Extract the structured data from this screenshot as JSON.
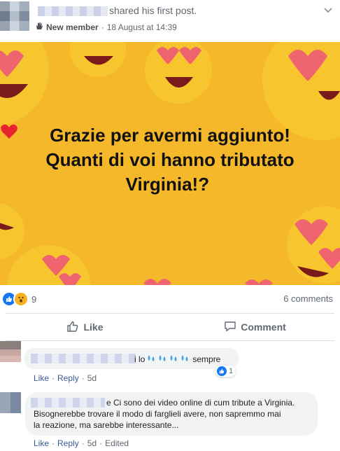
{
  "header": {
    "action_text": "shared his first post.",
    "badge_label": "New member",
    "timestamp": "18 August at 14:39"
  },
  "post_image": {
    "line1": "Grazie per avermi aggiunto!",
    "line2": "Quanti di voi hanno tributato",
    "line3": "Virginia!?",
    "background_color": "#f5b82a"
  },
  "reactions": {
    "count": "9",
    "icons": [
      "like-icon",
      "wow-icon"
    ],
    "comments_label": "6 comments"
  },
  "actions": {
    "like_label": "Like",
    "comment_label": "Comment"
  },
  "comments": [
    {
      "text_visible": "i lo",
      "text_end": "sempre",
      "reaction_count": "1",
      "like_label": "Like",
      "reply_label": "Reply",
      "time": "5d"
    },
    {
      "text_line1": "e Ci sono dei video online di cum tribute a Virginia.",
      "text_line2": "Bisognerebbe trovare il modo di farglieli avere, non sapremmo mai",
      "text_line3": "la reazione, ma sarebbe interessante...",
      "like_label": "Like",
      "reply_label": "Reply",
      "time": "5d",
      "edited_label": "Edited"
    }
  ]
}
